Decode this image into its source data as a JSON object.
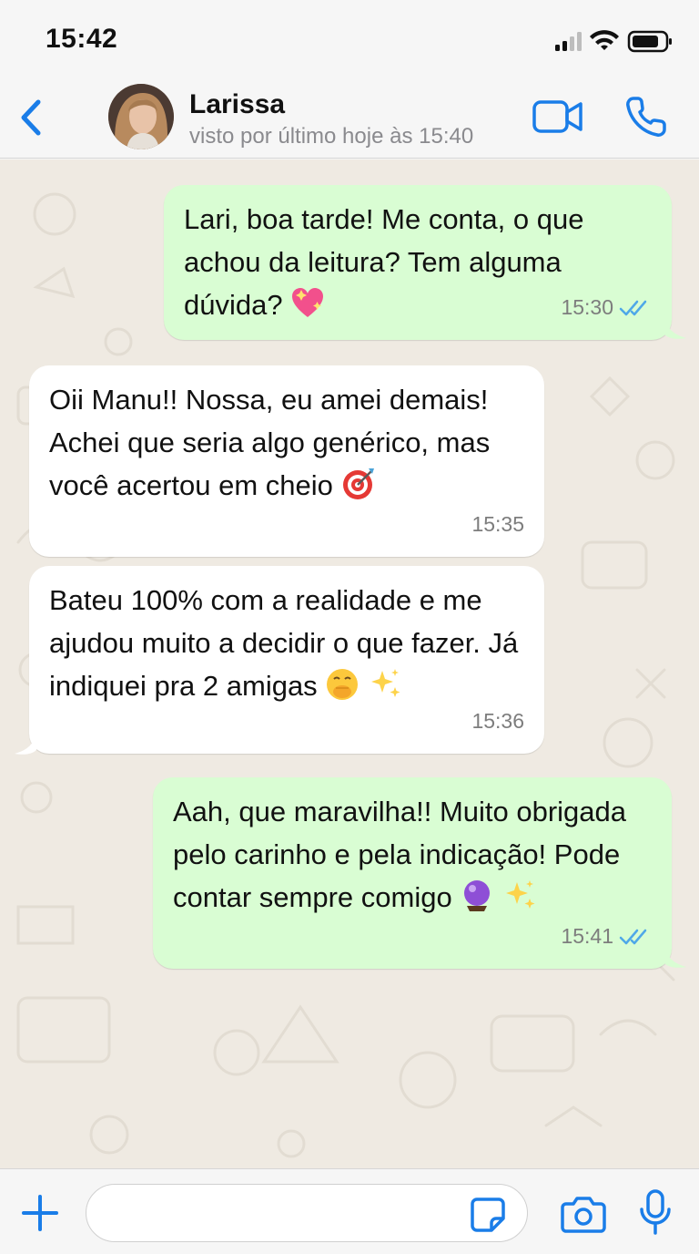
{
  "status_bar": {
    "time": "15:42"
  },
  "header": {
    "contact_name": "Larissa",
    "contact_status": "visto por último hoje às 15:40"
  },
  "messages": [
    {
      "direction": "out",
      "text": "Lari, boa tarde! Me conta, o que achou da leitura? Tem alguma dúvida?",
      "emoji": [
        "sparkling-heart"
      ],
      "time": "15:30",
      "read": true
    },
    {
      "direction": "in",
      "text": "Oii Manu!! Nossa, eu amei demais! Achei que seria algo genérico, mas você acertou em cheio",
      "emoji": [
        "direct-hit"
      ],
      "time": "15:35"
    },
    {
      "direction": "in",
      "text": "Bateu 100% com a realidade e me ajudou muito a decidir o que fazer. Já indiquei pra 2 amigas",
      "emoji": [
        "hand-over-mouth",
        "sparkles"
      ],
      "time": "15:36"
    },
    {
      "direction": "out",
      "text": "Aah, que maravilha!! Muito obrigada pelo carinho e pela indicação! Pode contar sempre comigo",
      "emoji": [
        "crystal-ball",
        "sparkles"
      ],
      "time": "15:41",
      "read": true
    }
  ],
  "input": {
    "placeholder": ""
  },
  "colors": {
    "accent": "#1a7de8",
    "outgoing_bubble": "#d9fdd3",
    "incoming_bubble": "#ffffff",
    "chat_background": "#efeae2",
    "read_tick": "#4fa8e8"
  }
}
